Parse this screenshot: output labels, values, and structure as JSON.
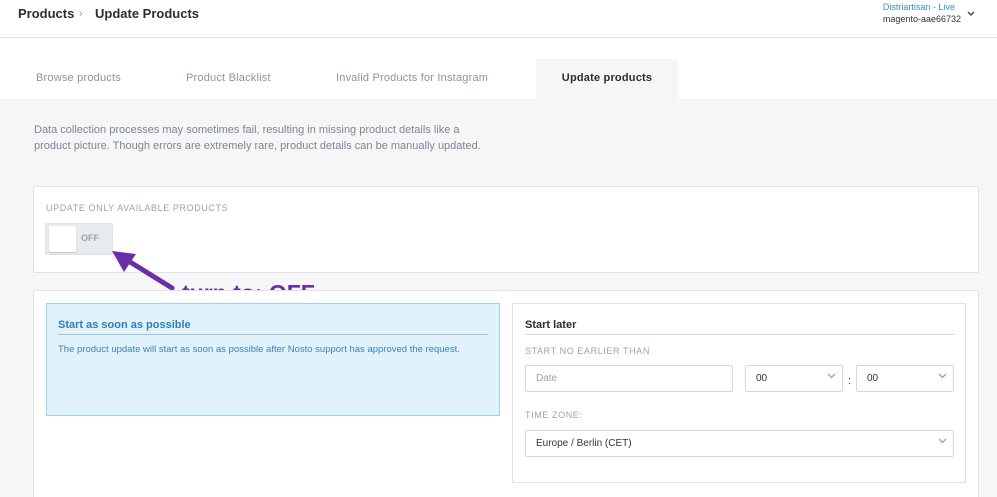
{
  "breadcrumb": {
    "root": "Products",
    "separator": "›",
    "current": "Update Products"
  },
  "account": {
    "name": "Distriartisan - Live",
    "id": "magento-aae66732"
  },
  "tabs": [
    {
      "label": "Browse products"
    },
    {
      "label": "Product Blacklist"
    },
    {
      "label": "Invalid Products for Instagram"
    },
    {
      "label": "Update products"
    }
  ],
  "active_tab": "Update products",
  "intro": "Data collection processes may sometimes fail, resulting in missing product details like a product picture. Though errors are extremely rare, product details can be manually updated.",
  "update_available": {
    "label": "UPDATE ONLY AVAILABLE PRODUCTS",
    "toggle_text": "OFF",
    "state": "off"
  },
  "annotation": "turn to: OFF",
  "annotation_color": "#6a2fa8",
  "start_asap": {
    "title": "Start as soon as possible",
    "text": "The product update will start as soon as possible after Nosto support has approved the request."
  },
  "start_later": {
    "title": "Start later",
    "no_earlier_label": "START NO EARLIER THAN",
    "date_placeholder": "Date",
    "hour": "00",
    "minute": "00",
    "time_separator": ":",
    "timezone_label": "TIME ZONE:",
    "timezone": "Europe / Berlin (CET)"
  },
  "icons": {
    "dropdown": "chevron-down-icon",
    "annotation": "arrow-icon"
  },
  "colors": {
    "accent": "#3a8fc6",
    "info_bg": "#e1f2fb",
    "info_border": "#9fd0ec"
  }
}
